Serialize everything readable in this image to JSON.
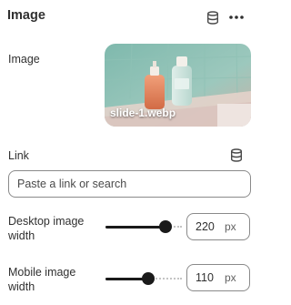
{
  "header": {
    "title": "Image",
    "data_icon": "database-icon",
    "more_icon": "more-horizontal-icon"
  },
  "image": {
    "label": "Image",
    "filename": "slide-1.webp"
  },
  "link": {
    "label": "Link",
    "placeholder": "Paste a link or search",
    "value": "",
    "source_icon": "database-icon"
  },
  "desktop_width": {
    "label_line1": "Desktop image",
    "label_line2": "width",
    "value": "220",
    "unit": "px",
    "slider_fraction": 0.78
  },
  "mobile_width": {
    "label_line1": "Mobile image",
    "label_line2": "width",
    "value": "110",
    "unit": "px",
    "slider_fraction": 0.56
  },
  "colors": {
    "text": "#303030",
    "border": "#8a8a8a",
    "slider": "#1a1a1a"
  }
}
